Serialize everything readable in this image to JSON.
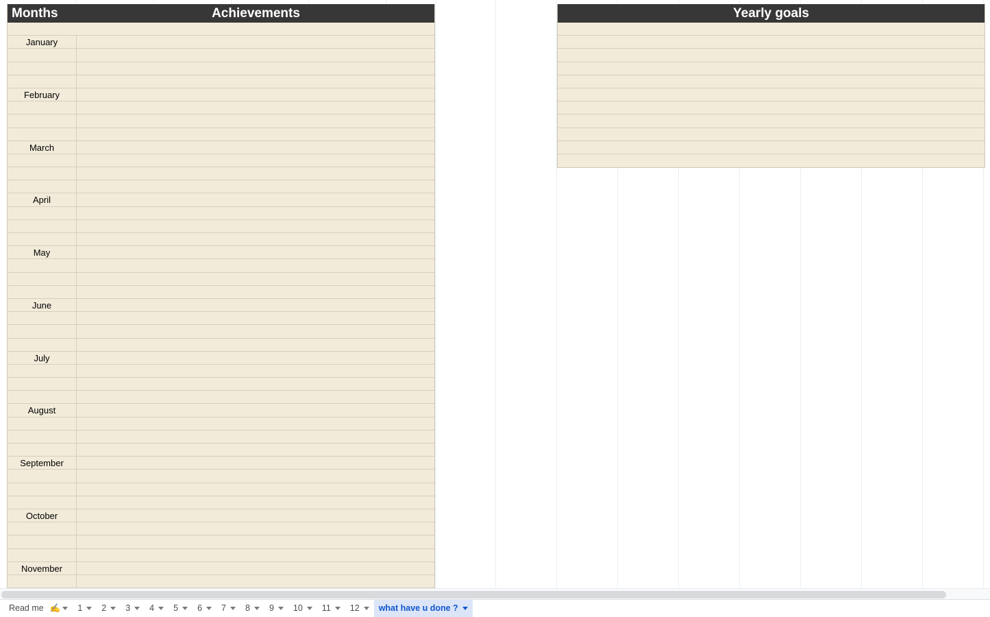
{
  "app": {
    "type": "spreadsheet"
  },
  "grid": {
    "column_line_positions": [
      110,
      224,
      337,
      450,
      563,
      635,
      723,
      812,
      901,
      990,
      1079,
      1168,
      1257,
      1346,
      1435
    ]
  },
  "tables": {
    "achievements": {
      "headers": [
        "Months",
        "Achievements"
      ],
      "months": [
        "January",
        "February",
        "March",
        "April",
        "May",
        "June",
        "July",
        "August",
        "September",
        "October",
        "November"
      ],
      "rows_per_month": 3,
      "lead_blank_rows": 1,
      "month_cells": [
        "",
        "January",
        "",
        "",
        "",
        "February",
        "",
        "",
        "",
        "March",
        "",
        "",
        "",
        "April",
        "",
        "",
        "",
        "May",
        "",
        "",
        "",
        "June",
        "",
        "",
        "",
        "July",
        "",
        "",
        "",
        "August",
        "",
        "",
        "",
        "September",
        "",
        "",
        "",
        "October",
        "",
        "",
        "",
        "November",
        "",
        ""
      ],
      "achievement_cells": [
        "",
        "",
        "",
        "",
        "",
        "",
        "",
        "",
        "",
        "",
        "",
        "",
        "",
        "",
        "",
        "",
        "",
        "",
        "",
        "",
        "",
        "",
        "",
        "",
        "",
        "",
        "",
        "",
        "",
        "",
        "",
        "",
        "",
        "",
        "",
        "",
        "",
        "",
        "",
        "",
        "",
        "",
        "",
        "",
        ""
      ]
    },
    "yearly_goals": {
      "header": "Yearly goals",
      "goal_cells": [
        "",
        "",
        "",
        "",
        "",
        "",
        "",
        "",
        "",
        "",
        ""
      ]
    }
  },
  "scrollbar": {
    "orientation": "horizontal",
    "thumb_label": "horizontal-scroll-thumb"
  },
  "tabbar": {
    "tabs": [
      {
        "label": "Read me",
        "emoji": "✍️",
        "active": false
      },
      {
        "label": "1",
        "emoji": "",
        "active": false
      },
      {
        "label": "2",
        "emoji": "",
        "active": false
      },
      {
        "label": "3",
        "emoji": "",
        "active": false
      },
      {
        "label": "4",
        "emoji": "",
        "active": false
      },
      {
        "label": "5",
        "emoji": "",
        "active": false
      },
      {
        "label": "6",
        "emoji": "",
        "active": false
      },
      {
        "label": "7",
        "emoji": "",
        "active": false
      },
      {
        "label": "8",
        "emoji": "",
        "active": false
      },
      {
        "label": "9",
        "emoji": "",
        "active": false
      },
      {
        "label": "10",
        "emoji": "",
        "active": false
      },
      {
        "label": "11",
        "emoji": "",
        "active": false
      },
      {
        "label": "12",
        "emoji": "",
        "active": false
      },
      {
        "label": "what have u done ?",
        "emoji": "",
        "active": true
      }
    ]
  },
  "colors": {
    "header_bg": "#373737",
    "header_text": "#ffffff",
    "cell_bg": "#f2ebda",
    "gridline": "#d6cfbe",
    "table_border": "#cfc8b8",
    "active_tab_bg": "#dce5f8",
    "active_tab_text": "#1155cc",
    "scroll_thumb": "#d8dadd",
    "page_bg": "#ffffff"
  }
}
